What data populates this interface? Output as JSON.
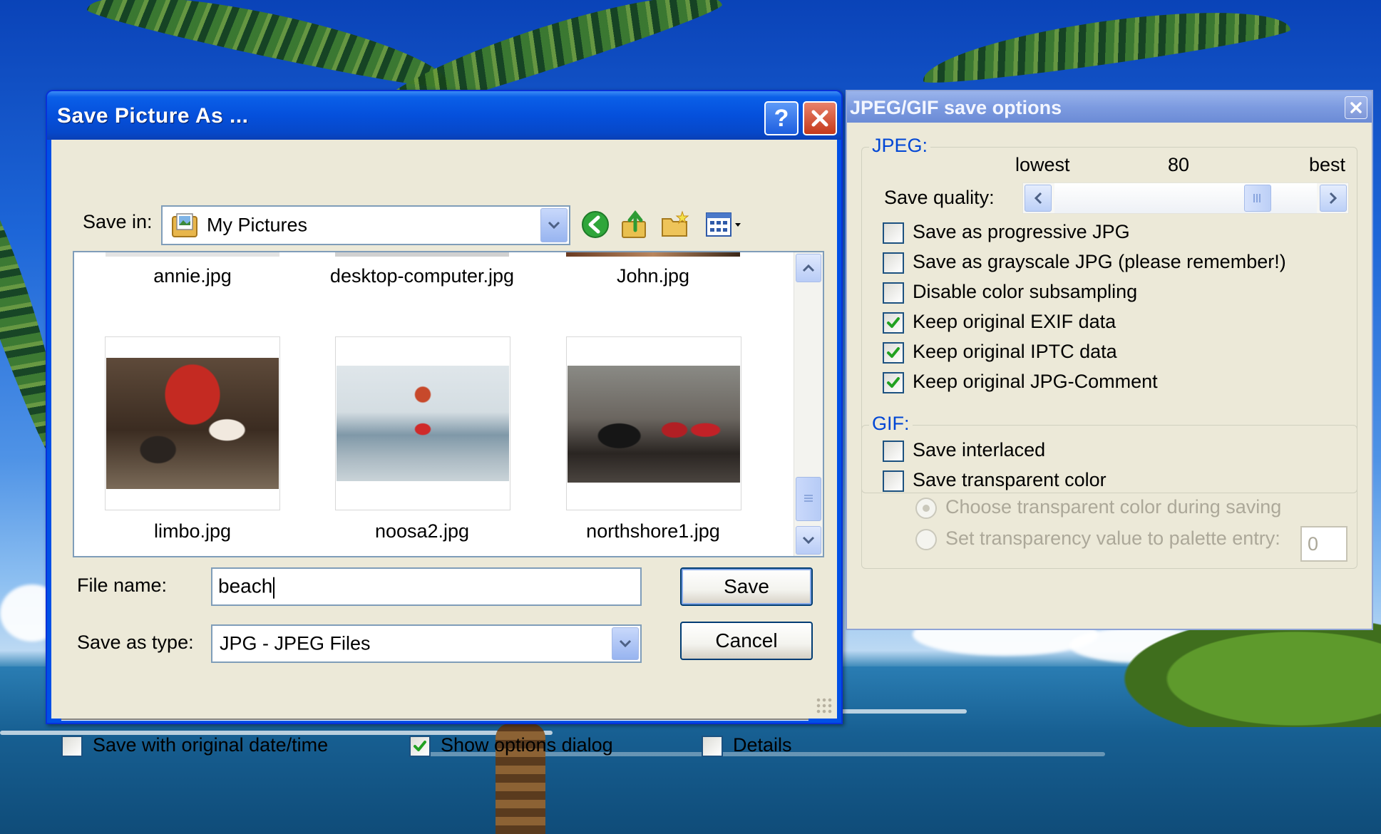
{
  "save_dialog": {
    "title": "Save Picture As ...",
    "save_in_label": "Save in:",
    "save_in_value": "My Pictures",
    "top_files": [
      "annie.jpg",
      "desktop-computer.jpg",
      "John.jpg"
    ],
    "files": [
      {
        "name": "limbo.jpg"
      },
      {
        "name": "noosa2.jpg"
      },
      {
        "name": "northshore1.jpg"
      }
    ],
    "file_name_label": "File name:",
    "file_name_value": "beach",
    "save_type_label": "Save as type:",
    "save_type_value": "JPG - JPEG Files",
    "save_button": "Save",
    "cancel_button": "Cancel",
    "checkboxes": {
      "original_date": {
        "label": "Save with original date/time",
        "checked": false
      },
      "show_options": {
        "label": "Show options dialog",
        "checked": true
      },
      "details": {
        "label": "Details",
        "checked": false
      }
    }
  },
  "options_window": {
    "title": "JPEG/GIF save options",
    "jpeg_group": "JPEG:",
    "quality": {
      "lowest_label": "lowest",
      "value": "80",
      "best_label": "best",
      "label": "Save quality:",
      "fraction": 0.8
    },
    "jpeg_options": [
      {
        "label": "Save as progressive JPG",
        "checked": false
      },
      {
        "label": "Save as grayscale JPG (please remember!)",
        "checked": false
      },
      {
        "label": "Disable color subsampling",
        "checked": false
      },
      {
        "label": "Keep original EXIF data",
        "checked": true
      },
      {
        "label": "Keep original IPTC data",
        "checked": true
      },
      {
        "label": "Keep original JPG-Comment",
        "checked": true
      }
    ],
    "gif_group": "GIF:",
    "gif_options": [
      {
        "label": "Save interlaced",
        "checked": false
      },
      {
        "label": "Save transparent color",
        "checked": false
      }
    ],
    "radio_choose": "Choose transparent color during saving",
    "radio_palette": "Set transparency value to palette entry:",
    "palette_entry": "0"
  },
  "colors": {
    "xp_blue": "#0050e6",
    "dialog_face": "#ece9d8",
    "group_title": "#0046d5"
  }
}
